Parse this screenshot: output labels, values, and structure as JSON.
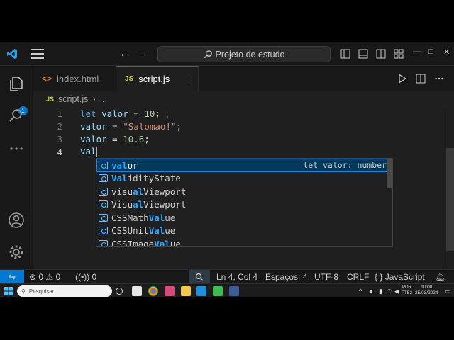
{
  "window": {
    "search_label": "Projeto de estudo",
    "window_controls": [
      "—",
      "□",
      "✕"
    ]
  },
  "activity_bar": {
    "items": [
      "files-icon",
      "search-icon",
      "more-icon"
    ],
    "explorer_badge": "1",
    "bottom_items": [
      "account-icon",
      "settings-gear-icon"
    ]
  },
  "tabs": [
    {
      "label": "index.html",
      "icon": "html-icon"
    },
    {
      "label": "script.js",
      "icon": "js-icon",
      "active": true,
      "unsaved": true
    }
  ],
  "tab_icons": {
    "html": "<>",
    "js": "JS"
  },
  "breadcrumb": {
    "file": "script.js",
    "more": "..."
  },
  "editor": {
    "line_numbers": [
      "1",
      "2",
      "3",
      "4"
    ],
    "lines": [
      {
        "var": "let",
        "name": "valor",
        "op": "=",
        "value": "10",
        "end": ";",
        "hint": "⁏"
      },
      {
        "name": "valor",
        "op": "=",
        "value": "\"Salomao!\"",
        "end": ";"
      },
      {
        "name": "valor",
        "op": "=",
        "value": "10.6",
        "end": ";"
      },
      {
        "name": "val"
      }
    ]
  },
  "suggest": {
    "items": [
      {
        "match": "val",
        "rest": "or",
        "detail": "let valor: number"
      },
      {
        "prefix": "",
        "match": "Val",
        "rest": "idityState"
      },
      {
        "prefix": "visu",
        "match": "al",
        "rest": "Viewport"
      },
      {
        "prefix": "Visu",
        "match": "al",
        "rest": "Viewport"
      },
      {
        "prefix": "CSSMath",
        "match": "Val",
        "rest": "ue"
      },
      {
        "prefix": "CSSUnit",
        "match": "Val",
        "rest": "ue"
      },
      {
        "prefix": "CSSImage",
        "match": "Val",
        "rest": "ue"
      }
    ]
  },
  "status": {
    "errors": "0",
    "warnings": "0",
    "ports": "0",
    "position": "Ln 4, Col 4",
    "spaces": "Espaços: 4",
    "encoding": "UTF-8",
    "eol": "CRLF",
    "language": "JavaScript"
  },
  "taskbar": {
    "search_placeholder": "Pesquisar",
    "lang_top": "POR",
    "lang_bottom": "PTB2",
    "time": "10:08",
    "date": "25/03/2024"
  },
  "colors": {
    "accent": "#0078d4",
    "keyword": "#569cd6",
    "string": "#ce9178",
    "number": "#b5cea8",
    "variable": "#9cdcfe"
  }
}
